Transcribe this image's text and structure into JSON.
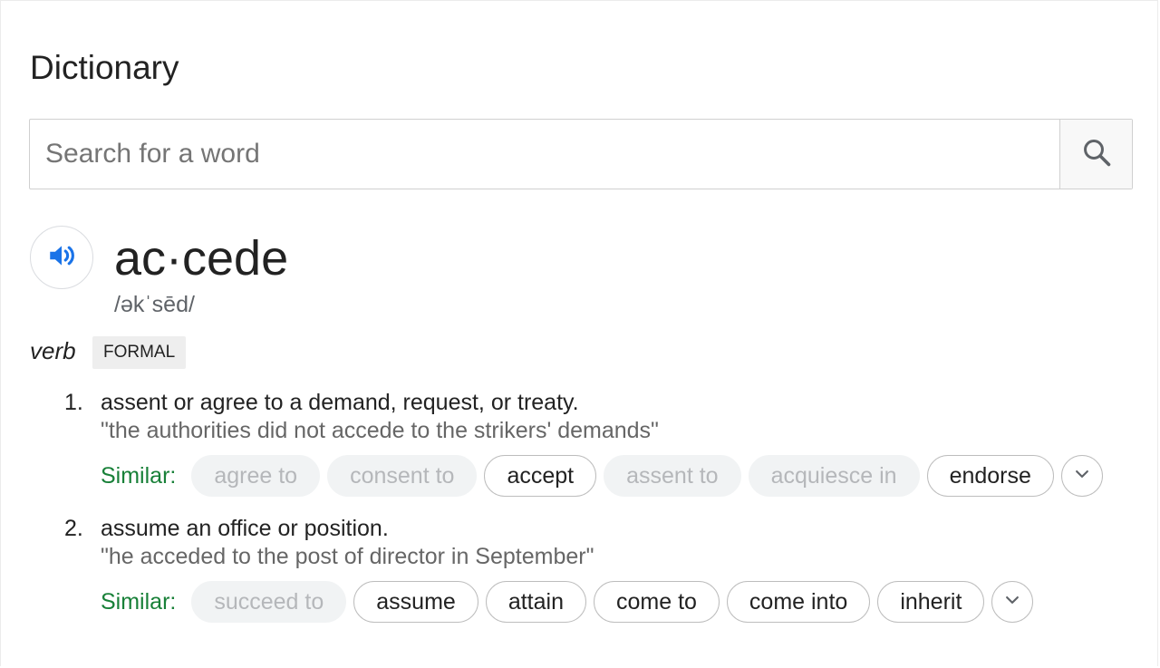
{
  "title": "Dictionary",
  "search": {
    "placeholder": "Search for a word",
    "icon": "search-icon"
  },
  "entry": {
    "audio_icon": "speaker-icon",
    "headword": "ac·cede",
    "phonetic": "/əkˈsēd/",
    "part_of_speech": "verb",
    "register": "FORMAL"
  },
  "similar_label": "Similar:",
  "senses": [
    {
      "number": "1.",
      "definition": "assent or agree to a demand, request, or treaty.",
      "example": "\"the authorities did not accede to the strikers' demands\"",
      "similar": [
        {
          "label": "agree to",
          "state": "muted"
        },
        {
          "label": "consent to",
          "state": "muted"
        },
        {
          "label": "accept",
          "state": "active"
        },
        {
          "label": "assent to",
          "state": "muted"
        },
        {
          "label": "acquiesce in",
          "state": "muted"
        },
        {
          "label": "endorse",
          "state": "active"
        }
      ],
      "expand_icon": "chevron-down-icon"
    },
    {
      "number": "2.",
      "definition": "assume an office or position.",
      "example": "\"he acceded to the post of director in September\"",
      "similar": [
        {
          "label": "succeed to",
          "state": "muted"
        },
        {
          "label": "assume",
          "state": "active"
        },
        {
          "label": "attain",
          "state": "active"
        },
        {
          "label": "come to",
          "state": "active"
        },
        {
          "label": "come into",
          "state": "active"
        },
        {
          "label": "inherit",
          "state": "active"
        }
      ],
      "expand_icon": "chevron-down-icon"
    }
  ],
  "colors": {
    "similar_label": "#188038",
    "audio_icon": "#1a73e8",
    "muted_chip_bg": "#f1f3f4",
    "muted_chip_text": "#b5b7ba"
  }
}
